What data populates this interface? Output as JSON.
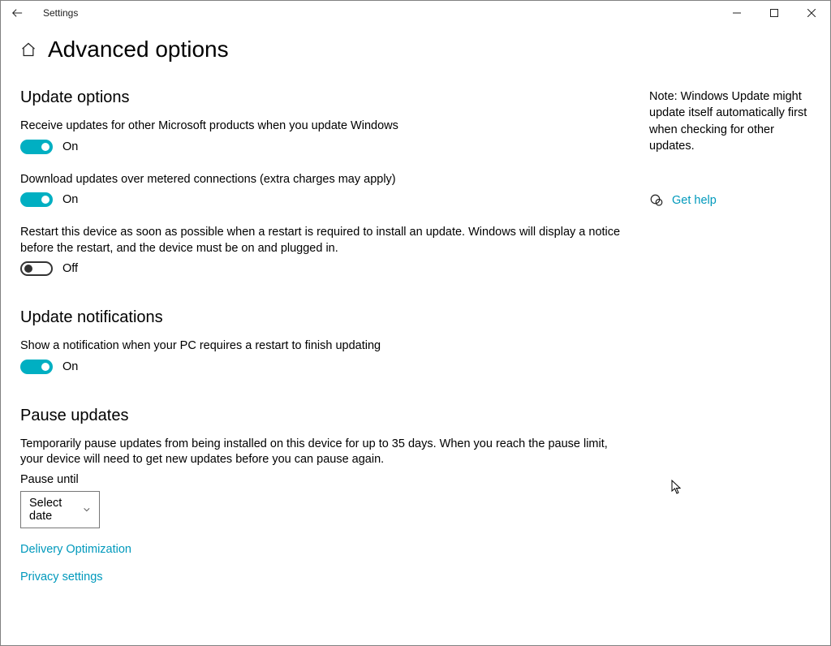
{
  "window": {
    "app_title": "Settings"
  },
  "page": {
    "title": "Advanced options"
  },
  "sections": {
    "update_options": {
      "title": "Update options",
      "items": [
        {
          "desc": "Receive updates for other Microsoft products when you update Windows",
          "state": "On",
          "on": true
        },
        {
          "desc": "Download updates over metered connections (extra charges may apply)",
          "state": "On",
          "on": true
        },
        {
          "desc": "Restart this device as soon as possible when a restart is required to install an update. Windows will display a notice before the restart, and the device must be on and plugged in.",
          "state": "Off",
          "on": false
        }
      ]
    },
    "update_notifications": {
      "title": "Update notifications",
      "items": [
        {
          "desc": "Show a notification when your PC requires a restart to finish updating",
          "state": "On",
          "on": true
        }
      ]
    },
    "pause_updates": {
      "title": "Pause updates",
      "desc": "Temporarily pause updates from being installed on this device for up to 35 days. When you reach the pause limit, your device will need to get new updates before you can pause again.",
      "field_label": "Pause until",
      "select_value": "Select date"
    }
  },
  "links": {
    "delivery": "Delivery Optimization",
    "privacy": "Privacy settings"
  },
  "side": {
    "note": "Note: Windows Update might update itself automatically first when checking for other updates.",
    "help": "Get help"
  }
}
